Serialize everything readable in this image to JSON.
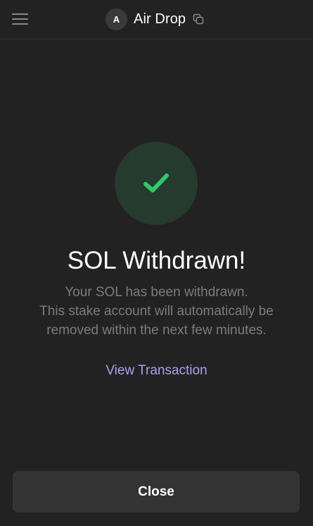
{
  "header": {
    "menu_icon": "hamburger-menu-icon",
    "avatar_letter": "A",
    "account_name": "Air Drop",
    "copy_icon": "copy-icon"
  },
  "status": {
    "icon": "checkmark-icon",
    "accent_color": "#2ec866",
    "circle_color": "#253b2d",
    "title": "SOL Withdrawn!",
    "description_lines": [
      "Your SOL has been withdrawn.",
      "This stake account will automatically be",
      "removed within the next few minutes."
    ]
  },
  "links": {
    "view_transaction": "View Transaction",
    "link_color": "#ab9ff2"
  },
  "footer": {
    "close_label": "Close"
  }
}
